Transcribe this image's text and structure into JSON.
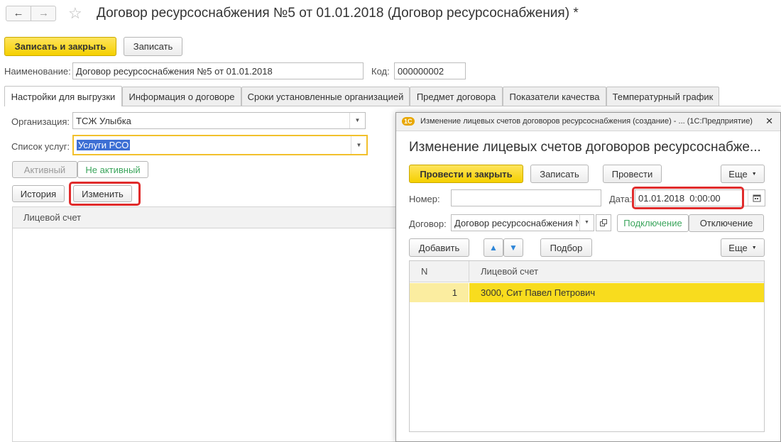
{
  "header": {
    "back_icon": "←",
    "forward_icon": "→",
    "star_icon": "☆",
    "title": "Договор ресурсоснабжения №5 от 01.01.2018 (Договор ресурсоснабжения) *"
  },
  "toolbar": {
    "save_close": "Записать и закрыть",
    "save": "Записать"
  },
  "form": {
    "name_label": "Наименование:",
    "name_value": "Договор ресурсоснабжения №5 от 01.01.2018",
    "code_label": "Код:",
    "code_value": "000000002"
  },
  "tabs": [
    {
      "label": "Настройки для выгрузки"
    },
    {
      "label": "Информация о договоре"
    },
    {
      "label": "Сроки установленные организацией"
    },
    {
      "label": "Предмет договора"
    },
    {
      "label": "Показатели качества"
    },
    {
      "label": "Температурный график"
    }
  ],
  "settings": {
    "org_label": "Организация:",
    "org_value": "ТСЖ Улыбка",
    "services_label": "Список услуг:",
    "services_value": "Услуги РСО",
    "active_label": "Активный",
    "inactive_label": "Не активный",
    "history_label": "История",
    "change_label": "Изменить",
    "account_header": "Лицевой счет"
  },
  "dialog": {
    "logo": "1С",
    "window_title": "Изменение лицевых счетов договоров ресурсоснабжения (создание) - ... (1С:Предприятие)",
    "close_icon": "✕",
    "heading": "Изменение лицевых счетов договоров ресурсоснабже...",
    "post_close": "Провести и закрыть",
    "save": "Записать",
    "post": "Провести",
    "more": "Еще",
    "number_label": "Номер:",
    "number_value": "",
    "date_label": "Дата:",
    "date_value": "01.01.2018  0:00:00",
    "contract_label": "Договор:",
    "contract_value": "Договор ресурсоснабжения №",
    "connect_label": "Подключение",
    "disconnect_label": "Отключение",
    "add_label": "Добавить",
    "up_icon": "▲",
    "down_icon": "▼",
    "selection_label": "Подбор",
    "more2": "Еще",
    "table": {
      "col_n": "N",
      "col_account": "Лицевой счет",
      "rows": [
        {
          "n": "1",
          "account": "3000, Сит Павел Петрович"
        }
      ]
    }
  }
}
